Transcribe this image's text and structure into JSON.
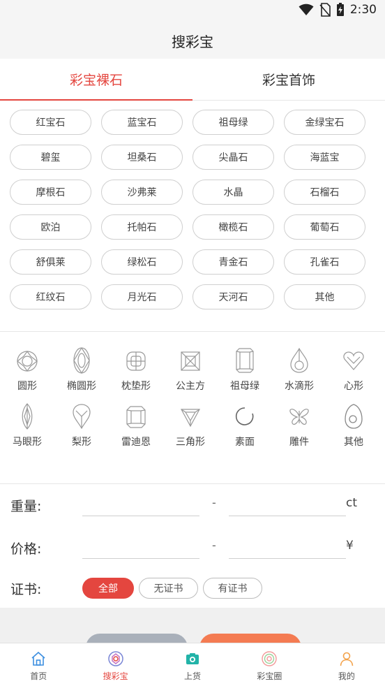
{
  "status_bar": {
    "time": "2:30"
  },
  "header": {
    "title": "搜彩宝"
  },
  "tabs": [
    {
      "label": "彩宝裸石",
      "active": true
    },
    {
      "label": "彩宝首饰",
      "active": false
    }
  ],
  "stone_types": [
    "红宝石",
    "蓝宝石",
    "祖母绿",
    "金绿宝石",
    "碧玺",
    "坦桑石",
    "尖晶石",
    "海蓝宝",
    "摩根石",
    "沙弗莱",
    "水晶",
    "石榴石",
    "欧泊",
    "托帕石",
    "橄榄石",
    "葡萄石",
    "舒俱莱",
    "绿松石",
    "青金石",
    "孔雀石",
    "红纹石",
    "月光石",
    "天河石",
    "其他"
  ],
  "cut_shapes": [
    {
      "label": "圆形",
      "icon": "round-cut-icon"
    },
    {
      "label": "椭圆形",
      "icon": "oval-cut-icon"
    },
    {
      "label": "枕垫形",
      "icon": "cushion-cut-icon"
    },
    {
      "label": "公主方",
      "icon": "princess-cut-icon"
    },
    {
      "label": "祖母绿",
      "icon": "emerald-cut-icon"
    },
    {
      "label": "水滴形",
      "icon": "pear-drop-cut-icon"
    },
    {
      "label": "心形",
      "icon": "heart-cut-icon"
    },
    {
      "label": "马眼形",
      "icon": "marquise-cut-icon"
    },
    {
      "label": "梨形",
      "icon": "pear-cut-icon"
    },
    {
      "label": "雷迪恩",
      "icon": "radiant-cut-icon"
    },
    {
      "label": "三角形",
      "icon": "trillion-cut-icon"
    },
    {
      "label": "素面",
      "icon": "cabochon-icon"
    },
    {
      "label": "雕件",
      "icon": "carving-icon"
    },
    {
      "label": "其他",
      "icon": "other-shape-icon"
    }
  ],
  "filters": {
    "weight": {
      "label": "重量:",
      "separator": "-",
      "unit": "ct"
    },
    "price": {
      "label": "价格:",
      "separator": "-",
      "unit": "¥"
    },
    "certificate": {
      "label": "证书:",
      "options": [
        "全部",
        "无证书",
        "有证书"
      ],
      "selected": "全部"
    }
  },
  "bottom_nav": [
    {
      "label": "首页",
      "icon": "home-icon",
      "active": false
    },
    {
      "label": "搜彩宝",
      "icon": "gem-search-icon",
      "active": true
    },
    {
      "label": "上货",
      "icon": "camera-icon",
      "active": false
    },
    {
      "label": "彩宝圈",
      "icon": "circle-community-icon",
      "active": false
    },
    {
      "label": "我的",
      "icon": "profile-icon",
      "active": false
    }
  ],
  "colors": {
    "accent": "#e4463f",
    "camera_teal": "#22b3a8",
    "profile_orange": "#f3a24a"
  }
}
